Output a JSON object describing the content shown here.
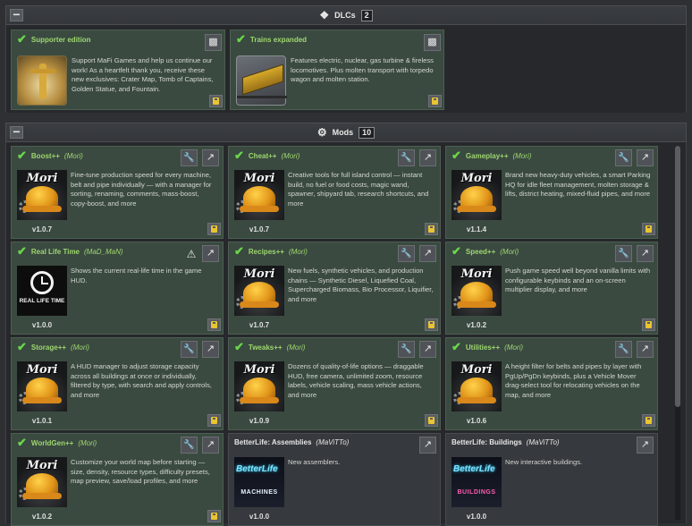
{
  "dlcs": {
    "title": "DLCs",
    "count": "2",
    "items": [
      {
        "title": "Supporter edition",
        "description": "Support MaFi Games and help us continue our work! As a heartfelt thank you, receive these new exclusives: Crater Map, Tomb of Captains, Golden Statue, and Fountain.",
        "icon": "steam-icon"
      },
      {
        "title": "Trains expanded",
        "description": "Features electric, nuclear, gas turbine & fireless locomotives. Plus molten transport with torpedo wagon and molten station.",
        "icon": "steam-icon"
      }
    ]
  },
  "mods": {
    "title": "Mods",
    "count": "10",
    "items": [
      {
        "title": "Boost++",
        "author": "Mori",
        "description": "Fine-tune production speed for every machine, belt and pipe individually — with a manager for sorting, renaming, comments, mass-boost, copy-boost, and more",
        "version": "v1.0.7",
        "thumb": "Mori"
      },
      {
        "title": "Cheat++",
        "author": "Mori",
        "description": "Creative tools for full island control — instant build, no fuel or food costs, magic wand, spawner, shipyard tab, research shortcuts, and more",
        "version": "v1.0.7",
        "thumb": "Mori"
      },
      {
        "title": "Gameplay++",
        "author": "Mori",
        "description": "Brand new heavy-duty vehicles, a smart Parking HQ for idle fleet management, molten storage & lifts, district heating, mixed-fluid pipes, and more",
        "version": "v1.1.4",
        "thumb": "Mori"
      },
      {
        "title": "Real Life Time",
        "author": "MaD_MaN",
        "description": "Shows the current real-life time in the game HUD.",
        "version": "v1.0.0",
        "thumb": "REAL LIFE TIME"
      },
      {
        "title": "Recipes++",
        "author": "Mori",
        "description": "New fuels, synthetic vehicles, and production chains — Synthetic Diesel, Liquefied Coal, Supercharged Biomass, Bio Processor, Liquifier, and more",
        "version": "v1.0.7",
        "thumb": "Mori"
      },
      {
        "title": "Speed++",
        "author": "Mori",
        "description": "Push game speed well beyond vanilla limits with configurable keybinds and an on-screen multiplier display, and more",
        "version": "v1.0.2",
        "thumb": "Mori"
      },
      {
        "title": "Storage++",
        "author": "Mori",
        "description": "A HUD manager to adjust storage capacity across all buildings at once or individually, filtered by type, with search and apply controls, and more",
        "version": "v1.0.1",
        "thumb": "Mori"
      },
      {
        "title": "Tweaks++",
        "author": "Mori",
        "description": "Dozens of quality-of-life options — draggable HUD, free camera, unlimited zoom, resource labels, vehicle scaling, mass vehicle actions, and more",
        "version": "v1.0.9",
        "thumb": "Mori"
      },
      {
        "title": "Utilities++",
        "author": "Mori",
        "description": "A height filter for belts and pipes by layer with PgUp/PgDn keybinds, plus a Vehicle Mover drag-select tool for relocating vehicles on the map, and more",
        "version": "v1.0.6",
        "thumb": "Mori"
      },
      {
        "title": "WorldGen++",
        "author": "Mori",
        "description": "Customize your world map before starting — size, density, resource types, difficulty presets, map preview, save/load profiles, and more",
        "version": "v1.0.2",
        "thumb": "Mori"
      },
      {
        "title": "BetterLife: Assemblies",
        "author": "MaViTTo",
        "description": "New assemblers.",
        "version": "v1.0.0",
        "thumb": "BetterLife",
        "sub": "MACHINES"
      },
      {
        "title": "BetterLife: Buildings",
        "author": "MaViTTo",
        "description": "New interactive buildings.",
        "version": "v1.0.0",
        "thumb": "BetterLife",
        "sub": "BUILDINGS"
      }
    ]
  },
  "symbols": {
    "check": "✔",
    "collapse": "−",
    "wrench": "🔧",
    "open": "↗",
    "warn": "⚠",
    "dlc": "❖",
    "mods": "⚙",
    "paren_open": "(",
    "paren_close": ")"
  }
}
